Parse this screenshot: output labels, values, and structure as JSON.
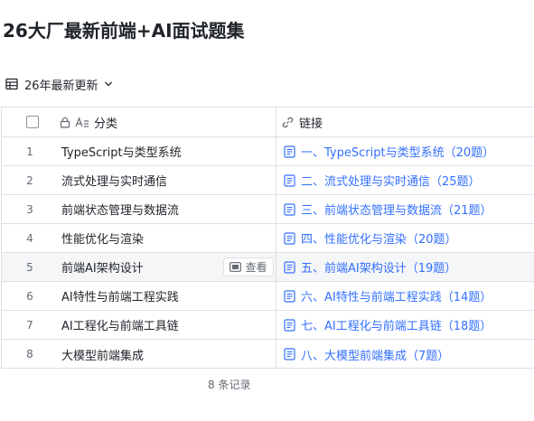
{
  "title": "26大厂最新前端+AI面试题集",
  "view": {
    "label": "26年最新更新",
    "icon": "grid-table-icon"
  },
  "table": {
    "columns": [
      {
        "label": "分类",
        "icons": [
          "lock-icon",
          "text-field-icon"
        ]
      },
      {
        "label": "链接",
        "icons": [
          "link-icon"
        ]
      }
    ],
    "rows": [
      {
        "index": "1",
        "name": "TypeScript与类型系统",
        "link": "一、TypeScript与类型系统（20题）"
      },
      {
        "index": "2",
        "name": "流式处理与实时通信",
        "link": "二、流式处理与实时通信（25题）"
      },
      {
        "index": "3",
        "name": "前端状态管理与数据流",
        "link": "三、前端状态管理与数据流（21题）"
      },
      {
        "index": "4",
        "name": "性能优化与渲染",
        "link": "四、性能优化与渲染（20题）"
      },
      {
        "index": "5",
        "name": "前端AI架构设计",
        "link": "五、前端AI架构设计（19题）"
      },
      {
        "index": "6",
        "name": "AI特性与前端工程实践",
        "link": "六、AI特性与前端工程实践（14题）"
      },
      {
        "index": "7",
        "name": "AI工程化与前端工具链",
        "link": "七、AI工程化与前端工具链（18题）"
      },
      {
        "index": "8",
        "name": "大模型前端集成",
        "link": "八、大模型前端集成（7题）"
      }
    ],
    "hovered_row_button": "查看"
  },
  "footer": {
    "record_count": "8 条记录"
  },
  "colors": {
    "link": "#3370ff",
    "border": "#dee0e3",
    "hover_row": "#f5f6f7"
  }
}
